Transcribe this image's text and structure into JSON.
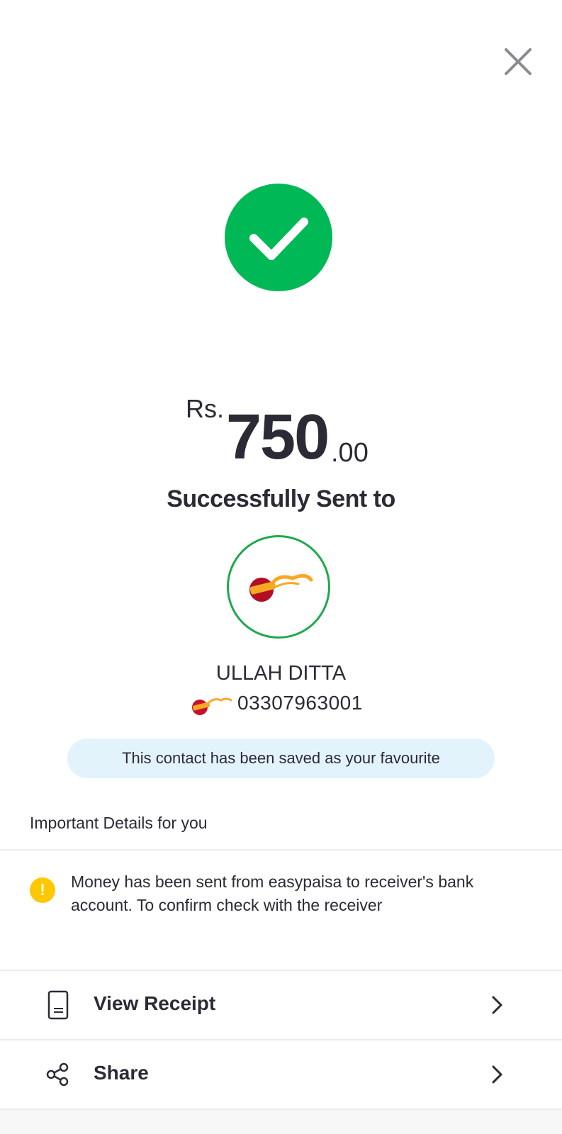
{
  "header": {
    "close_icon": "close-icon"
  },
  "status": {
    "icon": "checkmark-icon",
    "color": "#00b956"
  },
  "amount": {
    "currency": "Rs.",
    "whole": "750",
    "decimal": ".00"
  },
  "message": "Successfully Sent to",
  "recipient": {
    "logo": "jazzcash-logo",
    "name": "ULLAH DITTA",
    "number": "03307963001"
  },
  "favourite_banner": "This contact has been saved as your favourite",
  "details": {
    "heading": "Important Details for you",
    "notice_icon": "warning-icon",
    "notice_symbol": "!",
    "notice_text": "Money has been sent from easypaisa to receiver's bank account. To confirm check with the receiver"
  },
  "actions": [
    {
      "label": "View Receipt",
      "icon": "receipt-icon"
    },
    {
      "label": "Share",
      "icon": "share-icon"
    }
  ],
  "colors": {
    "success": "#00b956",
    "avatar_border": "#1fa84f",
    "banner_bg": "#e3f3fc",
    "warning": "#ffc800",
    "text": "#2b2a35"
  }
}
